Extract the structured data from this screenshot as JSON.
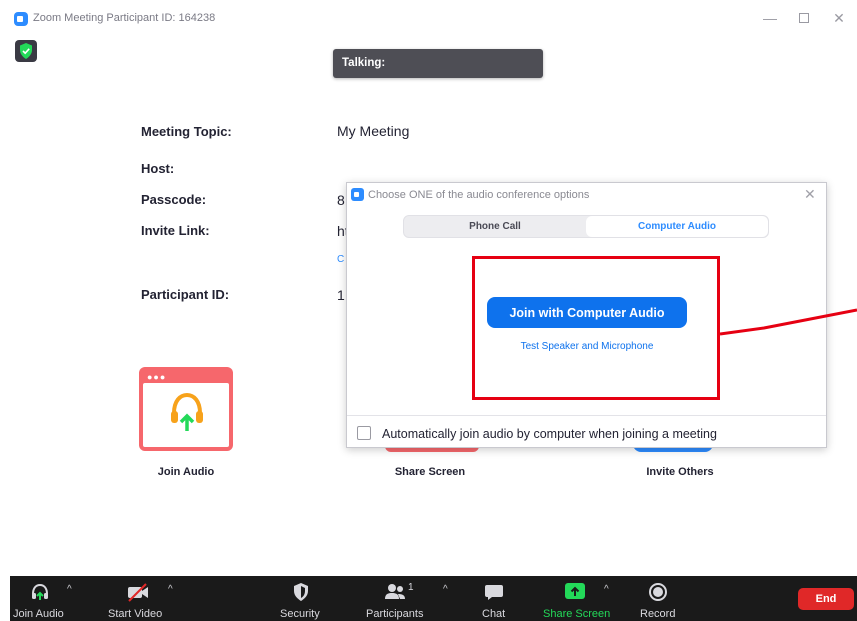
{
  "window": {
    "title": "Zoom Meeting Participant ID: 164238",
    "controls": {
      "minimize": "—",
      "close": "✕"
    }
  },
  "talking_indicator": {
    "label": "Talking:"
  },
  "meeting_info": {
    "topic_label": "Meeting Topic:",
    "topic_value": "My Meeting",
    "host_label": "Host:",
    "passcode_label": "Passcode:",
    "passcode_value_visible": "8",
    "invite_link_label": "Invite Link:",
    "invite_link_value_visible": "ht",
    "copy_link_visible": "C",
    "participant_id_label": "Participant ID:",
    "participant_id_value_visible": "1"
  },
  "tiles": [
    {
      "label": "Join Audio",
      "icon": "headphones-icon"
    },
    {
      "label": "Share Screen",
      "icon": "share-screen-icon"
    },
    {
      "label": "Invite Others",
      "icon": "invite-icon"
    }
  ],
  "audio_dialog": {
    "title": "Choose ONE of the audio conference options",
    "close_icon": "✕",
    "tabs": [
      {
        "label": "Phone Call",
        "selected": false
      },
      {
        "label": "Computer Audio",
        "selected": true
      }
    ],
    "join_button_label": "Join with Computer Audio",
    "test_link_label": "Test Speaker and Microphone",
    "auto_join_label": "Automatically join audio by computer when joining a meeting",
    "auto_join_checked": false
  },
  "annotation": {
    "highlight_color": "#e60012"
  },
  "toolbar": {
    "join_audio": "Join Audio",
    "start_video": "Start Video",
    "security": "Security",
    "participants": "Participants",
    "participants_count": "1",
    "chat": "Chat",
    "share_screen": "Share Screen",
    "record": "Record",
    "end": "End",
    "caret": "^"
  },
  "colors": {
    "zoom_blue": "#2D8CFF",
    "button_blue": "#0e72ed",
    "share_green": "#23d959",
    "end_red": "#e02828",
    "tile_red": "#f6676c"
  }
}
